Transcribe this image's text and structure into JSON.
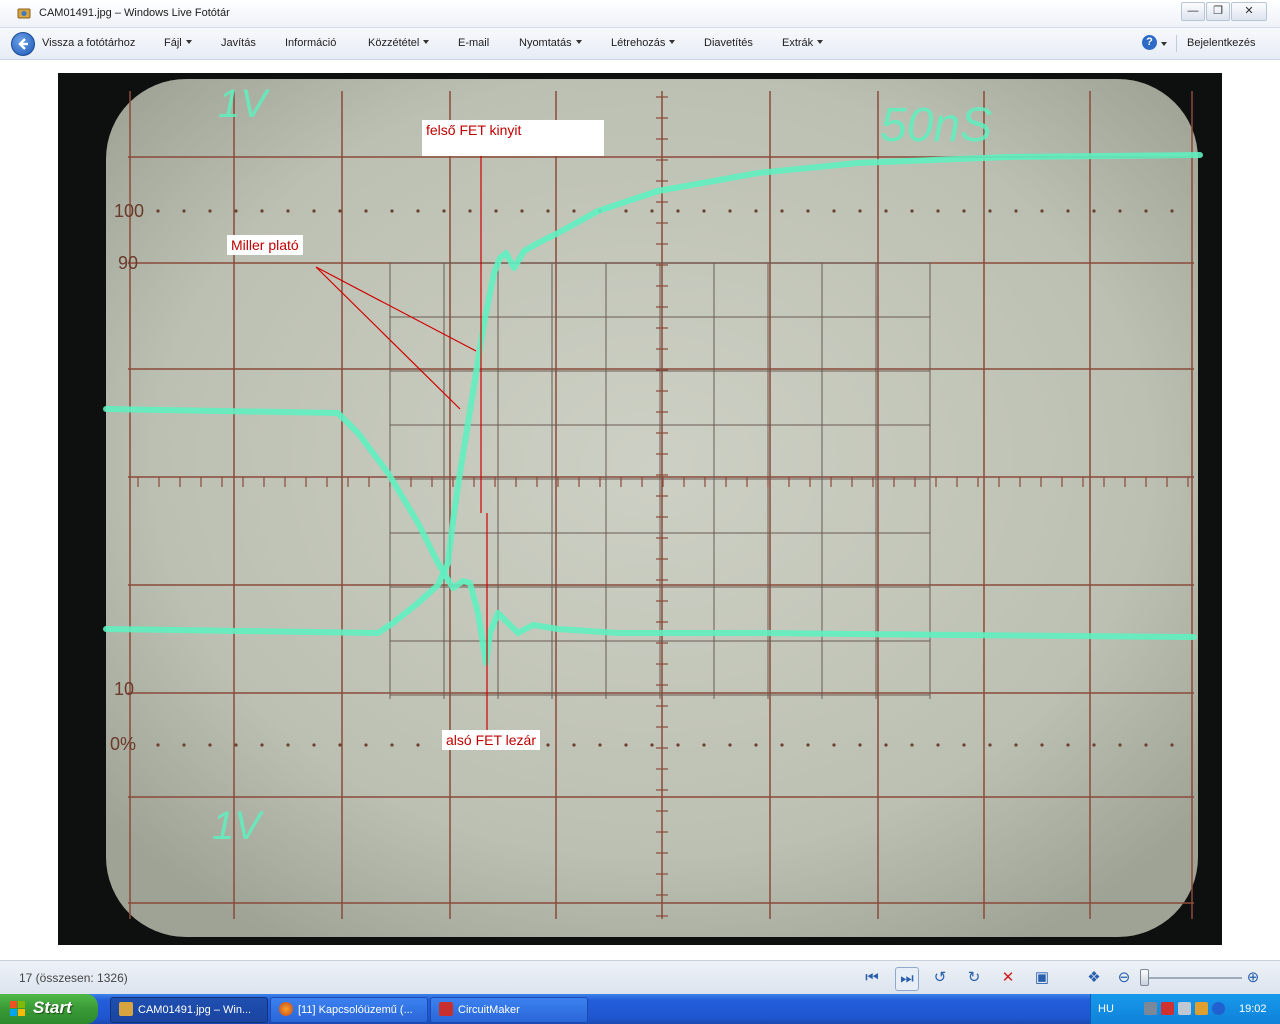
{
  "window": {
    "title": "CAM01491.jpg – Windows Live Fotótár"
  },
  "menubar": {
    "back_label": "Vissza a fotótárhoz",
    "items": [
      {
        "label": "Fájl",
        "dropdown": true
      },
      {
        "label": "Javítás",
        "dropdown": false
      },
      {
        "label": "Információ",
        "dropdown": false
      },
      {
        "label": "Közzététel",
        "dropdown": true
      },
      {
        "label": "E-mail",
        "dropdown": false
      },
      {
        "label": "Nyomtatás",
        "dropdown": true
      },
      {
        "label": "Létrehozás",
        "dropdown": true
      },
      {
        "label": "Diavetítés",
        "dropdown": false
      },
      {
        "label": "Extrák",
        "dropdown": true
      }
    ],
    "help_label": "?",
    "signin_label": "Bejelentkezés"
  },
  "photo": {
    "scope_labels": {
      "ch1_volts": "1V",
      "ch2_volts": "1V",
      "timebase": "50nS",
      "pct_100": "100",
      "pct_90": "90",
      "pct_10": "10",
      "pct_0": "0%"
    },
    "annotations": {
      "upper_fet": "felső FET kinyit",
      "miller": "Miller plató",
      "lower_fet": "alsó FET lezár"
    },
    "colors": {
      "screen": "#c2c6b9",
      "grid": "#8a4a3a",
      "trace": "#5ff0c0",
      "annotation": "#c00000"
    }
  },
  "statusbar": {
    "counter": "17 (összesen: 1326)",
    "icons": [
      "previous-icon",
      "next-icon",
      "rotate-left-icon",
      "rotate-right-icon",
      "delete-icon",
      "slideshow-icon",
      "fit-icon",
      "zoom-out-icon",
      "zoom-in-icon"
    ]
  },
  "taskbar": {
    "start_label": "Start",
    "tasks": [
      {
        "label": "CAM01491.jpg – Win..."
      },
      {
        "label": "[11] Kapcsolóüzemű (..."
      },
      {
        "label": "CircuitMaker"
      }
    ],
    "language": "HU",
    "clock": "19:02"
  }
}
